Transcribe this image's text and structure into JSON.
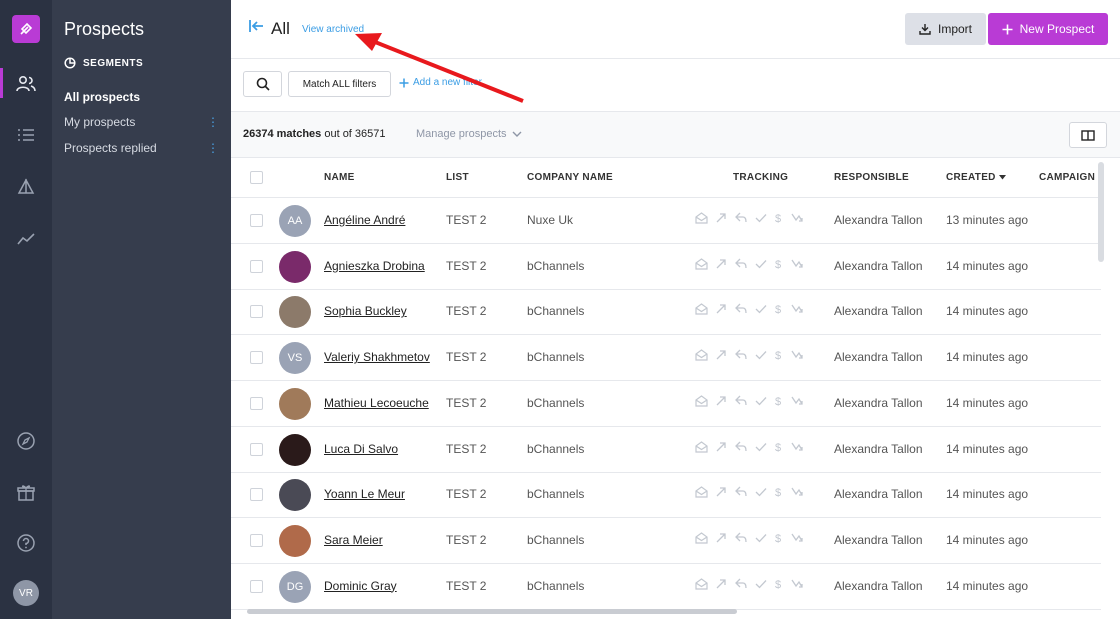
{
  "sidebar": {
    "title": "Prospects",
    "segments_heading": "SEGMENTS",
    "segments": [
      {
        "label": "All prospects"
      },
      {
        "label": "My prospects"
      },
      {
        "label": "Prospects replied"
      }
    ],
    "user_initials": "VR"
  },
  "header": {
    "title": "All",
    "view_archived": "View archived",
    "import_label": "Import",
    "new_prospect_label": "New Prospect"
  },
  "filters": {
    "match_label": "Match ALL filters",
    "add_filter_label": "Add a new filter"
  },
  "summary": {
    "matches": "26374 matches",
    "out_of": "out of 36571",
    "manage_label": "Manage prospects"
  },
  "table": {
    "columns": [
      "NAME",
      "LIST",
      "COMPANY NAME",
      "TRACKING",
      "RESPONSIBLE",
      "CREATED",
      "CAMPAIGN"
    ],
    "rows": [
      {
        "name": "Angéline André",
        "initials": "AA",
        "list": "TEST 2",
        "company": "Nuxe Uk",
        "responsible": "Alexandra Tallon",
        "created": "13 minutes ago",
        "avatar_color": "#9aa3b5"
      },
      {
        "name": "Agnieszka Drobina",
        "initials": "",
        "list": "TEST 2",
        "company": "bChannels",
        "responsible": "Alexandra Tallon",
        "created": "14 minutes ago",
        "avatar_color": "#7a2a6a"
      },
      {
        "name": "Sophia Buckley",
        "initials": "",
        "list": "TEST 2",
        "company": "bChannels",
        "responsible": "Alexandra Tallon",
        "created": "14 minutes ago",
        "avatar_color": "#8c7a6a"
      },
      {
        "name": "Valeriy Shakhmetov",
        "initials": "VS",
        "list": "TEST 2",
        "company": "bChannels",
        "responsible": "Alexandra Tallon",
        "created": "14 minutes ago",
        "avatar_color": "#9aa3b5"
      },
      {
        "name": "Mathieu Lecoeuche",
        "initials": "",
        "list": "TEST 2",
        "company": "bChannels",
        "responsible": "Alexandra Tallon",
        "created": "14 minutes ago",
        "avatar_color": "#a07a5a"
      },
      {
        "name": "Luca Di Salvo",
        "initials": "",
        "list": "TEST 2",
        "company": "bChannels",
        "responsible": "Alexandra Tallon",
        "created": "14 minutes ago",
        "avatar_color": "#2a1a1a"
      },
      {
        "name": "Yoann Le Meur",
        "initials": "",
        "list": "TEST 2",
        "company": "bChannels",
        "responsible": "Alexandra Tallon",
        "created": "14 minutes ago",
        "avatar_color": "#4a4a55"
      },
      {
        "name": "Sara Meier",
        "initials": "",
        "list": "TEST 2",
        "company": "bChannels",
        "responsible": "Alexandra Tallon",
        "created": "14 minutes ago",
        "avatar_color": "#b06a4a"
      },
      {
        "name": "Dominic Gray",
        "initials": "DG",
        "list": "TEST 2",
        "company": "bChannels",
        "responsible": "Alexandra Tallon",
        "created": "14 minutes ago",
        "avatar_color": "#9aa3b5"
      }
    ]
  },
  "colors": {
    "brand": "#b93bd5",
    "link": "#3b9de4",
    "annotation_arrow": "#e8191d"
  }
}
